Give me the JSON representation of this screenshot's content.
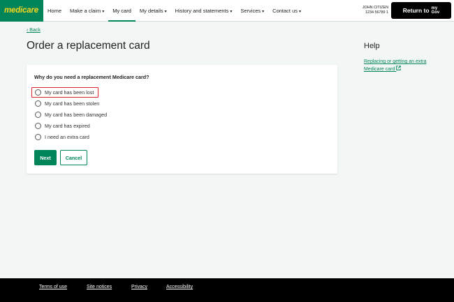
{
  "header": {
    "logo": "medicare",
    "nav": [
      {
        "label": "Home",
        "caret": ""
      },
      {
        "label": "Make a claim",
        "caret": "▾"
      },
      {
        "label": "My card",
        "caret": ""
      },
      {
        "label": "My details",
        "caret": "▾"
      },
      {
        "label": "History and statements",
        "caret": "▾"
      },
      {
        "label": "Services",
        "caret": "▾"
      },
      {
        "label": "Contact us",
        "caret": "▾"
      }
    ],
    "active_tab": "My card",
    "user_name": "JOHN CITIZEN",
    "user_number": "1234 56789 1",
    "return_label": "Return to",
    "mygov_top": "my",
    "mygov_bottom": "Gov"
  },
  "main": {
    "back_label": "Back",
    "title": "Order a replacement card",
    "question": "Why do you need a replacement Medicare card?",
    "options": [
      "My card has been lost",
      "My card has been stolen",
      "My card has been damaged",
      "My card has expired",
      "I need an extra card"
    ],
    "highlighted_option": "My card has been lost",
    "next_label": "Next",
    "cancel_label": "Cancel"
  },
  "help": {
    "title": "Help",
    "link_line1": "Replacing or getting an extra",
    "link_line2": "Medicare card"
  },
  "footer": {
    "links": [
      "Terms of use",
      "Site notices",
      "Privacy",
      "Accessibility"
    ]
  },
  "colors": {
    "brand_green": "#00845a",
    "logo_yellow": "#f7d61c",
    "highlight_red": "#d9232b",
    "page_bg": "#f2f7f5"
  }
}
